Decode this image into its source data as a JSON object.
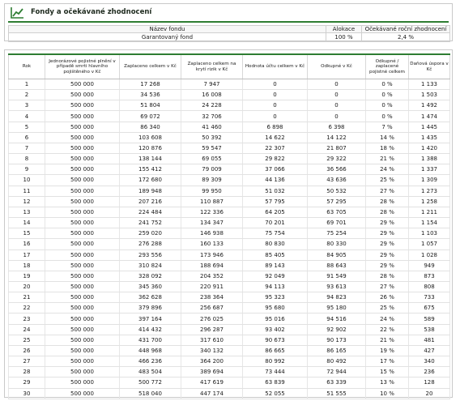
{
  "section1": {
    "title": "Fondy a očekávané zhodnocení",
    "columns": [
      "Název fondu",
      "Alokace",
      "Očekávané roční zhodnocení"
    ],
    "rows": [
      [
        "Garantovaný fond",
        "100 %",
        "2,4 %"
      ]
    ]
  },
  "table": {
    "headers": [
      "Rok",
      "Jednorázové pojistné plnění v případě smrti hlavního pojištěného v Kč",
      "Zaplaceno celkem v Kč",
      "Zaplaceno celkem na krytí rizik v Kč",
      "Hodnota účtu celkem v Kč",
      "Odkupné v Kč",
      "Odkupné / zaplacené pojistné celkem",
      "Daňová úspora v Kč"
    ],
    "rows": [
      [
        "1",
        "500 000",
        "17 268",
        "7 947",
        "0",
        "0",
        "0 %",
        "1 133"
      ],
      [
        "2",
        "500 000",
        "34 536",
        "16 008",
        "0",
        "0",
        "0 %",
        "1 503"
      ],
      [
        "3",
        "500 000",
        "51 804",
        "24 228",
        "0",
        "0",
        "0 %",
        "1 492"
      ],
      [
        "4",
        "500 000",
        "69 072",
        "32 706",
        "0",
        "0",
        "0 %",
        "1 474"
      ],
      [
        "5",
        "500 000",
        "86 340",
        "41 460",
        "6 898",
        "6 398",
        "7 %",
        "1 445"
      ],
      [
        "6",
        "500 000",
        "103 608",
        "50 392",
        "14 622",
        "14 122",
        "14 %",
        "1 435"
      ],
      [
        "7",
        "500 000",
        "120 876",
        "59 547",
        "22 307",
        "21 807",
        "18 %",
        "1 420"
      ],
      [
        "8",
        "500 000",
        "138 144",
        "69 055",
        "29 822",
        "29 322",
        "21 %",
        "1 388"
      ],
      [
        "9",
        "500 000",
        "155 412",
        "79 009",
        "37 066",
        "36 566",
        "24 %",
        "1 337"
      ],
      [
        "10",
        "500 000",
        "172 680",
        "89 309",
        "44 136",
        "43 636",
        "25 %",
        "1 309"
      ],
      [
        "11",
        "500 000",
        "189 948",
        "99 950",
        "51 032",
        "50 532",
        "27 %",
        "1 273"
      ],
      [
        "12",
        "500 000",
        "207 216",
        "110 887",
        "57 795",
        "57 295",
        "28 %",
        "1 258"
      ],
      [
        "13",
        "500 000",
        "224 484",
        "122 336",
        "64 205",
        "63 705",
        "28 %",
        "1 211"
      ],
      [
        "14",
        "500 000",
        "241 752",
        "134 347",
        "70 201",
        "69 701",
        "29 %",
        "1 154"
      ],
      [
        "15",
        "500 000",
        "259 020",
        "146 938",
        "75 754",
        "75 254",
        "29 %",
        "1 103"
      ],
      [
        "16",
        "500 000",
        "276 288",
        "160 133",
        "80 830",
        "80 330",
        "29 %",
        "1 057"
      ],
      [
        "17",
        "500 000",
        "293 556",
        "173 946",
        "85 405",
        "84 905",
        "29 %",
        "1 028"
      ],
      [
        "18",
        "500 000",
        "310 824",
        "188 694",
        "89 143",
        "88 643",
        "29 %",
        "949"
      ],
      [
        "19",
        "500 000",
        "328 092",
        "204 352",
        "92 049",
        "91 549",
        "28 %",
        "873"
      ],
      [
        "20",
        "500 000",
        "345 360",
        "220 911",
        "94 113",
        "93 613",
        "27 %",
        "808"
      ],
      [
        "21",
        "500 000",
        "362 628",
        "238 364",
        "95 323",
        "94 823",
        "26 %",
        "733"
      ],
      [
        "22",
        "500 000",
        "379 896",
        "256 687",
        "95 680",
        "95 180",
        "25 %",
        "675"
      ],
      [
        "23",
        "500 000",
        "397 164",
        "276 025",
        "95 016",
        "94 516",
        "24 %",
        "589"
      ],
      [
        "24",
        "500 000",
        "414 432",
        "296 287",
        "93 402",
        "92 902",
        "22 %",
        "538"
      ],
      [
        "25",
        "500 000",
        "431 700",
        "317 610",
        "90 673",
        "90 173",
        "21 %",
        "481"
      ],
      [
        "26",
        "500 000",
        "448 968",
        "340 132",
        "86 665",
        "86 165",
        "19 %",
        "427"
      ],
      [
        "27",
        "500 000",
        "466 236",
        "364 200",
        "80 992",
        "80 492",
        "17 %",
        "340"
      ],
      [
        "28",
        "500 000",
        "483 504",
        "389 694",
        "73 444",
        "72 944",
        "15 %",
        "236"
      ],
      [
        "29",
        "500 000",
        "500 772",
        "417 619",
        "63 839",
        "63 339",
        "13 %",
        "128"
      ],
      [
        "30",
        "500 000",
        "518 040",
        "447 174",
        "52 055",
        "51 555",
        "10 %",
        "20"
      ]
    ]
  }
}
